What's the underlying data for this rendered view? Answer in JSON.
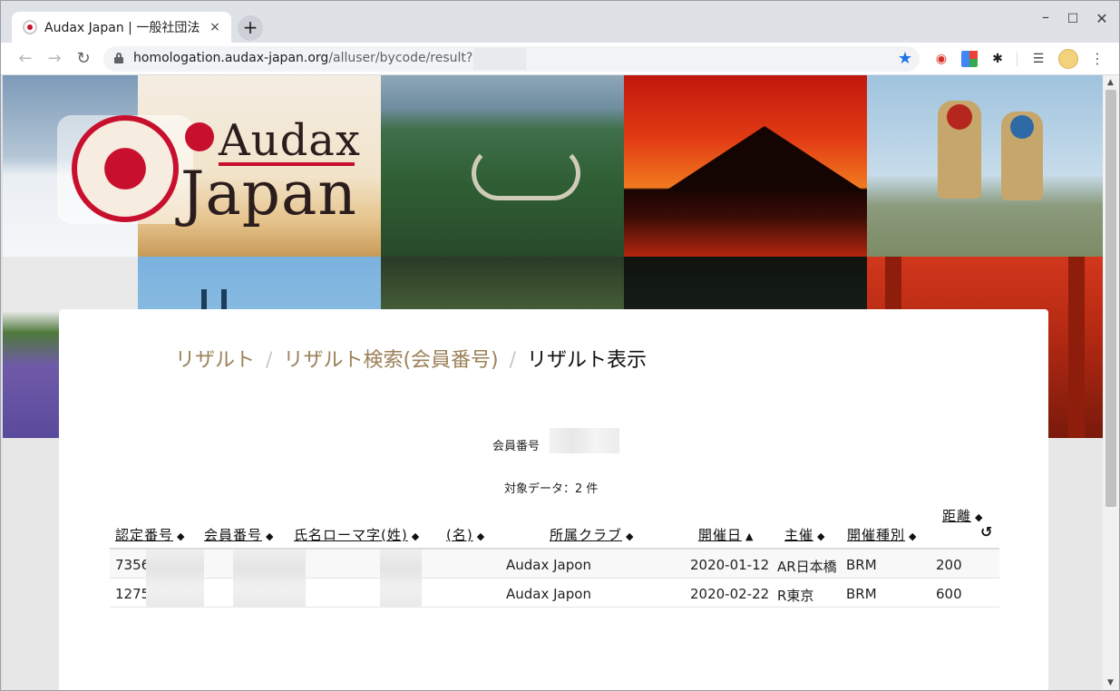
{
  "browser": {
    "tab_title": "Audax Japan | 一般社団法",
    "tab_close": "×",
    "new_tab": "+",
    "window_controls": {
      "minimize": "–",
      "maximize": "☐",
      "close": "✕"
    },
    "nav": {
      "back": "←",
      "forward": "→",
      "reload": "↻"
    },
    "url_host": "homologation.audax-japan.org",
    "url_path": "/alluser/bycode/result?code=",
    "star": "★",
    "menu": "⋮",
    "extensions": [
      "red-extension-icon",
      "google-translate-icon",
      "paw-extension-icon",
      "media-queue-icon",
      "profile-avatar"
    ]
  },
  "header": {
    "logo_line1": "Audax",
    "logo_line2": "Japan"
  },
  "breadcrumb": {
    "items": [
      "リザルト",
      "リザルト検索(会員番号)"
    ],
    "separator": "/",
    "current": "リザルト表示"
  },
  "summary": {
    "member_label": "会員番号",
    "count_label": "対象データ：2 件"
  },
  "table": {
    "headers": {
      "cert": "認定番号",
      "member": "会員番号",
      "roman_last": "氏名ローマ字(姓)",
      "roman_first": "(名)",
      "club": "所属クラブ",
      "date": "開催日",
      "host": "主催",
      "type": "開催種別",
      "distance": "距離"
    },
    "sort_both": "◆",
    "sort_asc": "▲",
    "reset": "↺",
    "rows": [
      {
        "cert": "735661",
        "club": "Audax Japon",
        "date": "2020-01-12",
        "host": "AR日本橋",
        "type": "BRM",
        "distance": "200"
      },
      {
        "cert": "127578",
        "club": "Audax Japon",
        "date": "2020-02-22",
        "host": "R東京",
        "type": "BRM",
        "distance": "600"
      }
    ]
  },
  "colors": {
    "crumb_link": "#9b8159",
    "brand_red": "#c8102e",
    "bookmark_star": "#1a73e8"
  }
}
